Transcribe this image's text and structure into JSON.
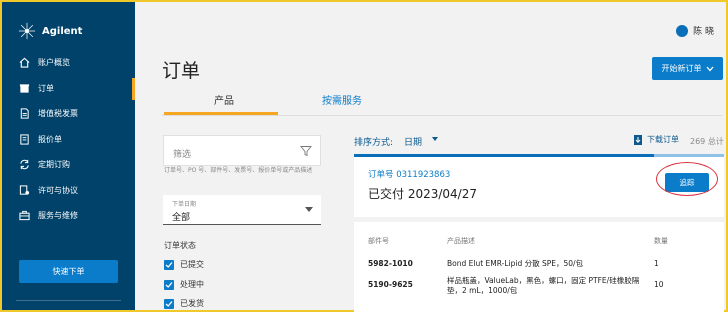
{
  "sidebar": {
    "brand": "Agilent",
    "items": [
      {
        "label": "账户概览",
        "icon": "home-icon"
      },
      {
        "label": "订单",
        "icon": "box-icon"
      },
      {
        "label": "增值税发票",
        "icon": "invoice-icon"
      },
      {
        "label": "报价单",
        "icon": "quote-icon"
      },
      {
        "label": "定期订购",
        "icon": "repeat-icon"
      },
      {
        "label": "许可与协议",
        "icon": "license-icon"
      },
      {
        "label": "服务与维修",
        "icon": "briefcase-icon"
      }
    ],
    "active_index": 1,
    "quick_order_label": "快速下单"
  },
  "header": {
    "user_name": "陈 晓",
    "page_title": "订单",
    "new_order_label": "开始新订单"
  },
  "tabs": [
    {
      "label": "产品",
      "active": true
    },
    {
      "label": "按需服务",
      "active": false
    }
  ],
  "filter": {
    "placeholder": "筛选",
    "hint": "订单号、PO 号、部件号、发票号、报价单号或产品描述",
    "date_label": "下单日期",
    "date_value": "全部",
    "status_title": "订单状态",
    "statuses": [
      "已提交",
      "处理中",
      "已发货"
    ]
  },
  "sort": {
    "label": "排序方式:",
    "value": "日期",
    "download_label": "下载订单",
    "total_text": "269 总计"
  },
  "order": {
    "number_text": "订单号 0311923863",
    "status_text": "已交付 2023/04/27",
    "track_label": "追踪",
    "columns": [
      "部件号",
      "产品描述",
      "数量"
    ],
    "rows": [
      {
        "part": "5982-1010",
        "desc": "Bond Elut EMR-Lipid 分散 SPE，50/包",
        "qty": "1"
      },
      {
        "part": "5190-9625",
        "desc": "样品瓶盖，ValueLab，黑色，螺口，固定 PTFE/硅橡胶隔垫，2 mL，1000/包",
        "qty": "10"
      }
    ]
  },
  "colors": {
    "sidebar": "#00426a",
    "accent_blue": "#0a7cc9",
    "tab_underline": "#f5a623",
    "annotation_red": "#d9333f",
    "frame_yellow": "#f0c82a"
  }
}
